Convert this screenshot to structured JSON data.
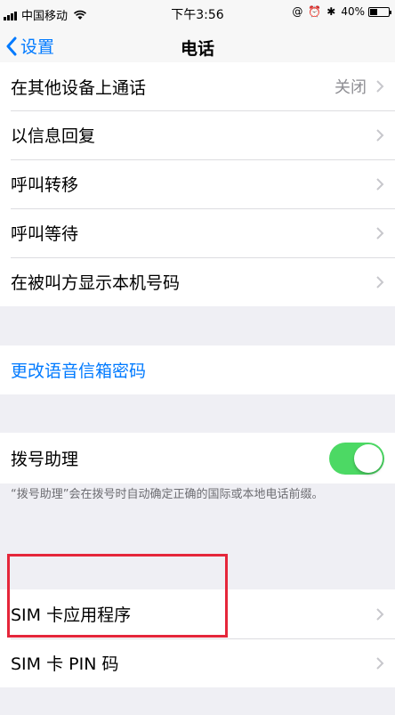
{
  "status_bar": {
    "carrier": "中国移动",
    "time": "下午3:56",
    "battery_percent": "40%",
    "battery_level": 0.4,
    "icons": [
      "signal-icon",
      "wifi-icon",
      "location-icon",
      "alarm-icon",
      "bluetooth-icon",
      "battery-icon"
    ]
  },
  "nav": {
    "back_label": "设置",
    "title": "电话"
  },
  "group1": {
    "rows": [
      {
        "label": "在其他设备上通话",
        "value": "关闭"
      },
      {
        "label": "以信息回复"
      },
      {
        "label": "呼叫转移"
      },
      {
        "label": "呼叫等待"
      },
      {
        "label": "在被叫方显示本机号码"
      }
    ]
  },
  "group2": {
    "link_label": "更改语音信箱密码"
  },
  "group3": {
    "label": "拨号助理",
    "toggle_on": true,
    "footnote": "“拨号助理”会在拨号时自动确定正确的国际或本地电话前缀。"
  },
  "group4": {
    "rows": [
      {
        "label": "SIM 卡应用程序"
      },
      {
        "label": "SIM 卡 PIN 码"
      }
    ]
  },
  "colors": {
    "accent": "#007aff",
    "toggle_on": "#4cd964",
    "highlight": "#e5263a",
    "background": "#efeff4"
  }
}
